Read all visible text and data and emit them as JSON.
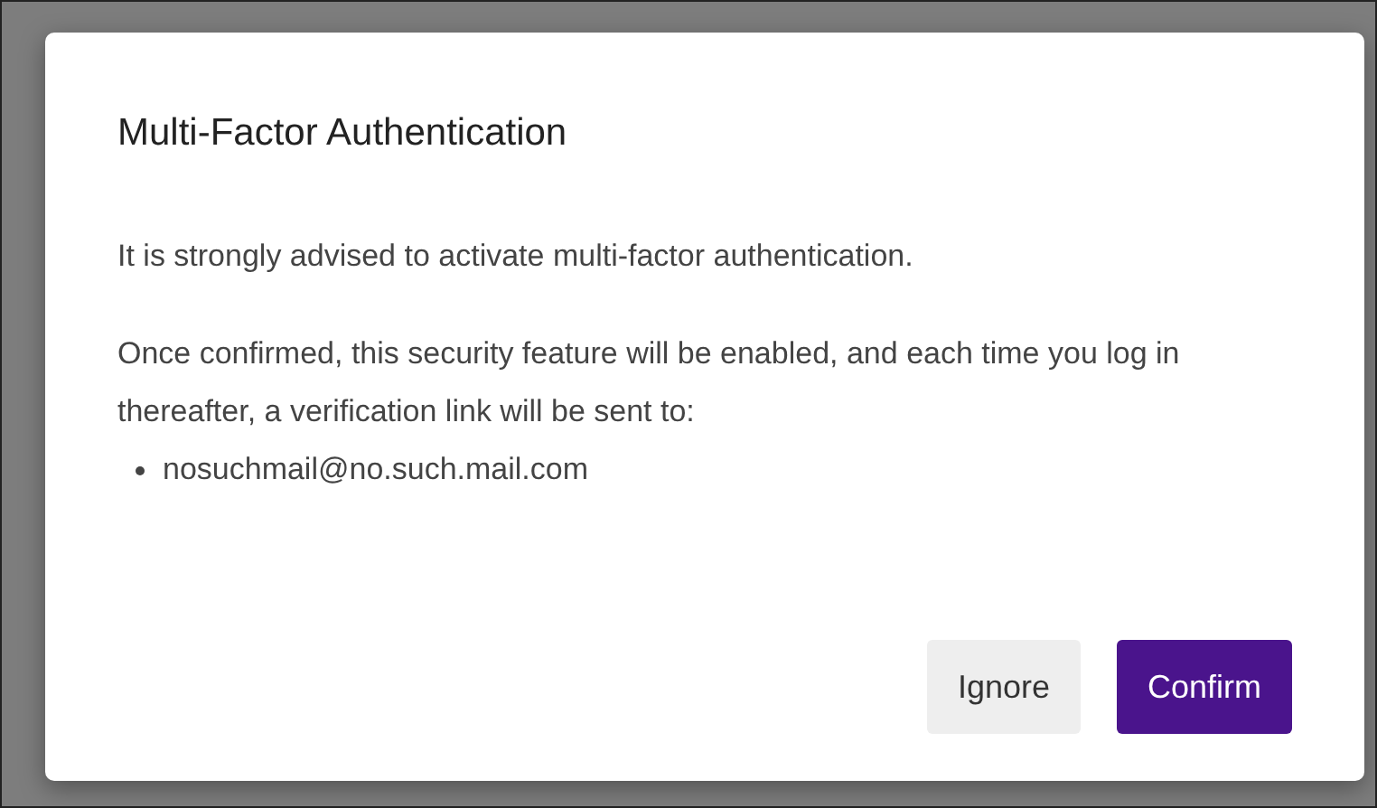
{
  "dialog": {
    "title": "Multi-Factor Authentication",
    "paragraphs": [
      "It is strongly advised to activate multi-factor authentication.",
      "Once confirmed, this security feature will be enabled, and each time you log in thereafter, a verification link will be sent to:"
    ],
    "recipients": [
      "nosuchmail@no.such.mail.com"
    ],
    "buttons": [
      {
        "label": "Ignore",
        "kind": "secondary"
      },
      {
        "label": "Confirm",
        "kind": "primary"
      }
    ]
  }
}
